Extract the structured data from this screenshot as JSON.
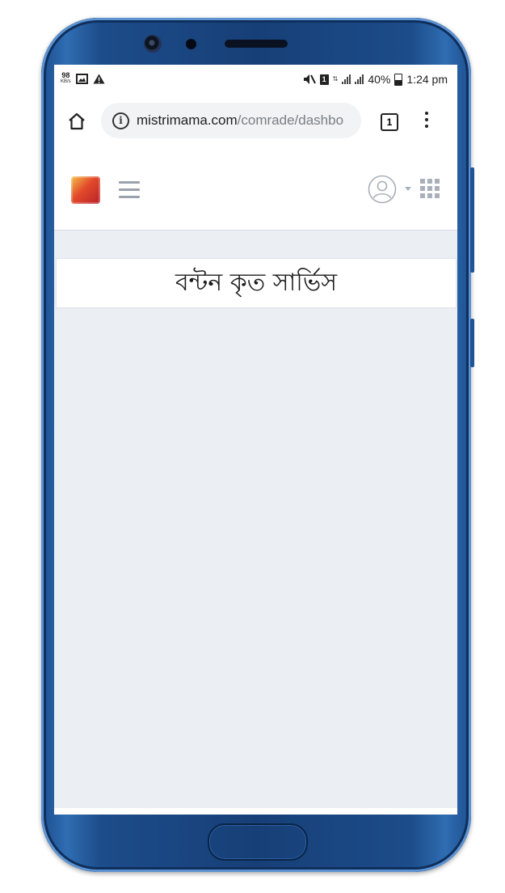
{
  "statusbar": {
    "net_speed": "98",
    "net_unit": "KB/s",
    "battery_percent": "40%",
    "time": "1:24 pm",
    "sim_label": "1",
    "network_label": "4G"
  },
  "browser": {
    "url_domain": "mistrimama.com",
    "url_path": "/comrade/dashbo",
    "tab_count": "1"
  },
  "page": {
    "heading": "বন্টন কৃত সার্ভিস"
  },
  "colors": {
    "phone_body": "#173f77",
    "page_background": "#ebeff4",
    "card_background": "#ffffff"
  }
}
